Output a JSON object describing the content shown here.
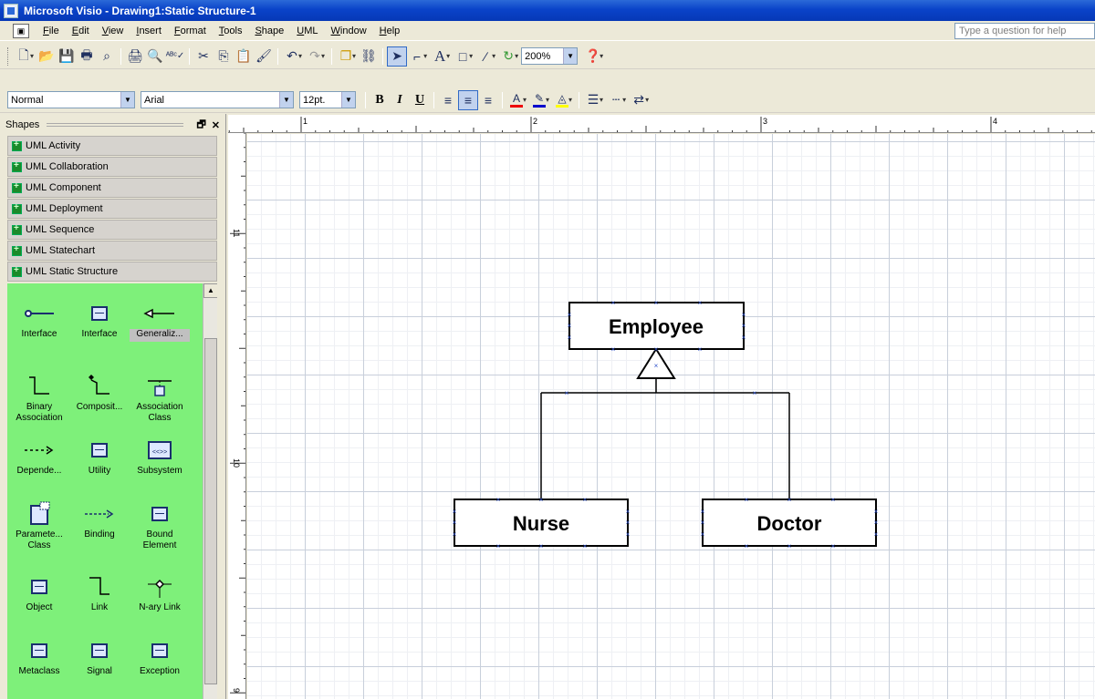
{
  "window": {
    "title": "Microsoft Visio - Drawing1:Static Structure-1"
  },
  "menu": {
    "items": [
      "File",
      "Edit",
      "View",
      "Insert",
      "Format",
      "Tools",
      "Shape",
      "UML",
      "Window",
      "Help"
    ],
    "help_placeholder": "Type a question for help"
  },
  "toolbar": {
    "zoom": "200%"
  },
  "format_toolbar": {
    "style": "Normal",
    "font": "Arial",
    "size": "12pt.",
    "bold": "B",
    "italic": "I",
    "underline": "U"
  },
  "shapes_pane": {
    "title": "Shapes",
    "stencils": [
      "UML Activity",
      "UML Collaboration",
      "UML Component",
      "UML Deployment",
      "UML Sequence",
      "UML Statechart",
      "UML Static Structure"
    ],
    "masters": [
      {
        "label": "Interface",
        "icon": "interface-lollipop-icon"
      },
      {
        "label": "Interface",
        "icon": "interface-box-icon"
      },
      {
        "label": "Generaliz...",
        "icon": "generalization-icon"
      },
      {
        "label": "Binary Association",
        "icon": "binary-association-icon"
      },
      {
        "label": "Composit...",
        "icon": "composition-icon"
      },
      {
        "label": "Association Class",
        "icon": "association-class-icon"
      },
      {
        "label": "Depende...",
        "icon": "dependency-icon"
      },
      {
        "label": "Utility",
        "icon": "utility-icon"
      },
      {
        "label": "Subsystem",
        "icon": "subsystem-icon"
      },
      {
        "label": "Paramete... Class",
        "icon": "parameterized-class-icon"
      },
      {
        "label": "Binding",
        "icon": "binding-icon"
      },
      {
        "label": "Bound Element",
        "icon": "bound-element-icon"
      },
      {
        "label": "Object",
        "icon": "object-icon"
      },
      {
        "label": "Link",
        "icon": "link-icon"
      },
      {
        "label": "N-ary Link",
        "icon": "nary-link-icon"
      },
      {
        "label": "Metaclass",
        "icon": "metaclass-icon"
      },
      {
        "label": "Signal",
        "icon": "signal-icon"
      },
      {
        "label": "Exception",
        "icon": "exception-icon"
      }
    ]
  },
  "rulers": {
    "top_marks": [
      "1",
      "2",
      "3",
      "4"
    ],
    "left_marks": [
      "11",
      "10",
      "9"
    ]
  },
  "diagram": {
    "classes": [
      {
        "id": "employee",
        "name": "Employee"
      },
      {
        "id": "nurse",
        "name": "Nurse"
      },
      {
        "id": "doctor",
        "name": "Doctor"
      }
    ],
    "relations": [
      {
        "type": "generalization",
        "parent": "employee",
        "children": [
          "nurse",
          "doctor"
        ]
      }
    ]
  },
  "colors": {
    "titlebar": "#0a43c9",
    "stencil_bg": "#7ef07a",
    "handle": "#3355cc"
  }
}
